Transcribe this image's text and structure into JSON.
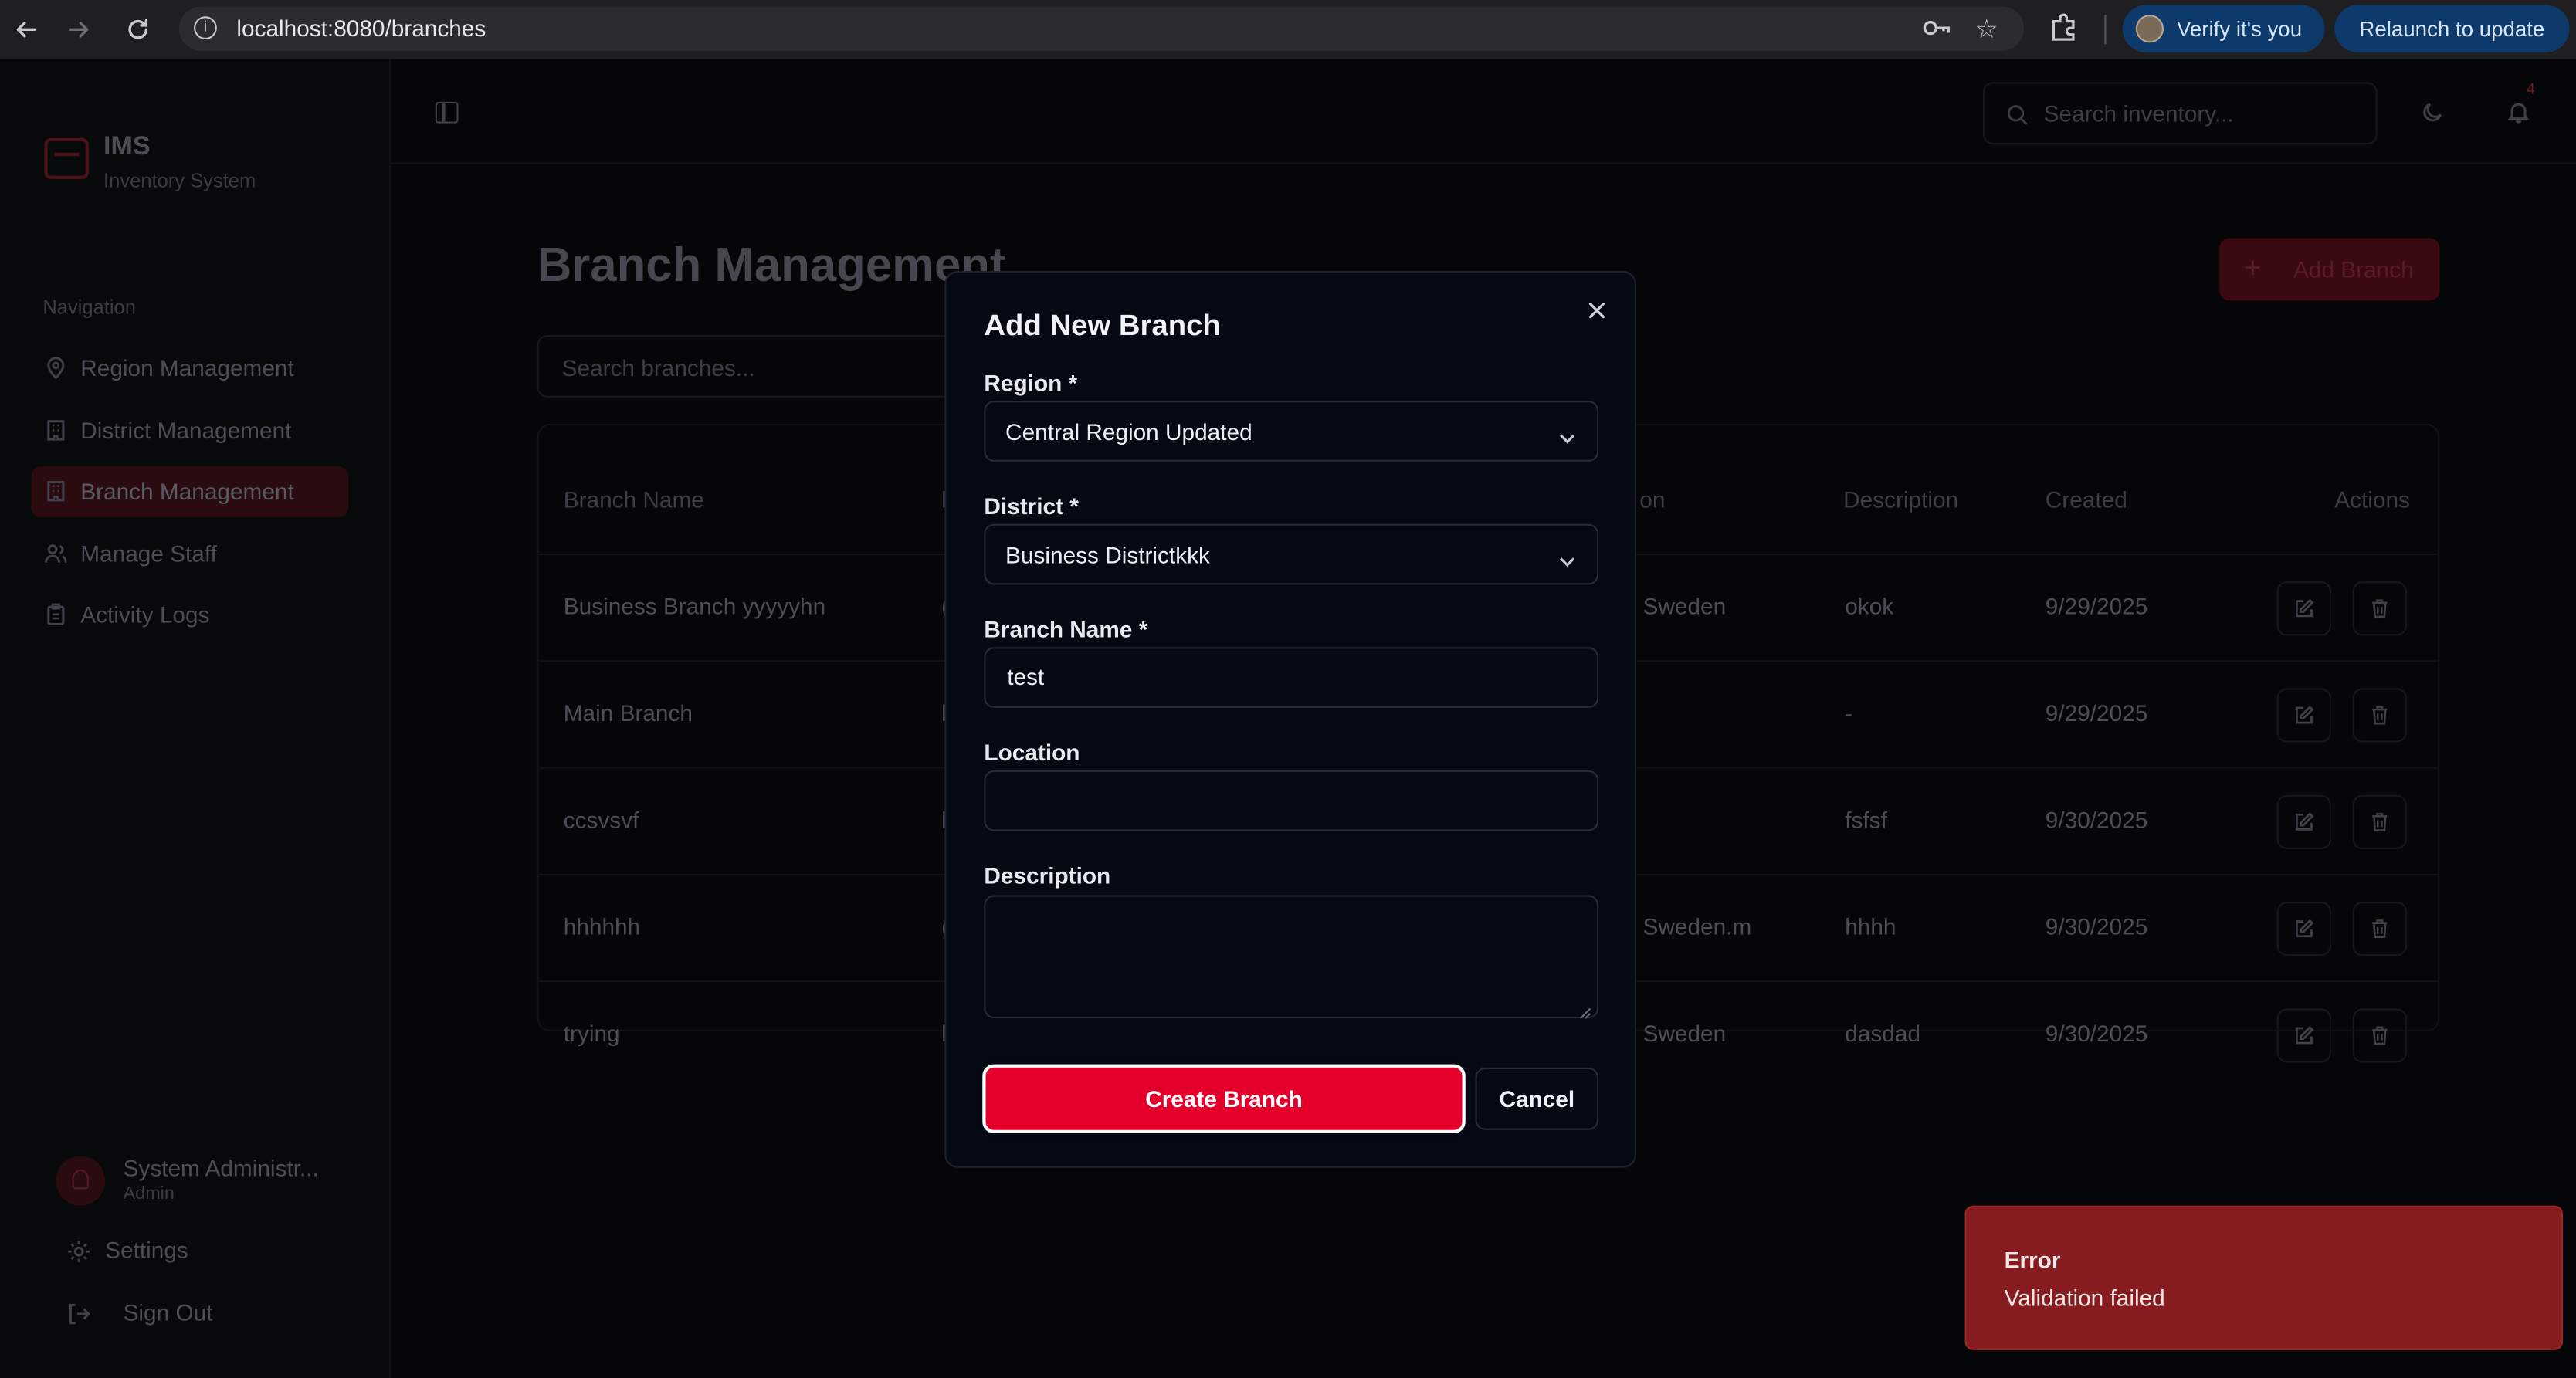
{
  "browser": {
    "url": "localhost:8080/branches",
    "verify_label": "Verify it's you",
    "relaunch_label": "Relaunch to update"
  },
  "sidebar": {
    "brand_title": "IMS",
    "brand_subtitle": "Inventory System",
    "nav_heading": "Navigation",
    "items": [
      {
        "label": "Region Management",
        "icon": "map-pin-icon"
      },
      {
        "label": "District Management",
        "icon": "building-icon"
      },
      {
        "label": "Branch Management",
        "icon": "building-icon",
        "active": true
      },
      {
        "label": "Manage Staff",
        "icon": "users-icon"
      },
      {
        "label": "Activity Logs",
        "icon": "clipboard-icon"
      }
    ],
    "user_name": "System Administr...",
    "user_role": "Admin",
    "settings_label": "Settings",
    "signout_label": "Sign Out"
  },
  "topbar": {
    "search_placeholder": "Search inventory...",
    "notification_count": "4"
  },
  "page": {
    "title": "Branch Management",
    "add_button": "Add Branch",
    "search_placeholder": "Search branches..."
  },
  "table": {
    "headers": {
      "name": "Branch Name",
      "col2": "l",
      "location": "on",
      "description": "Description",
      "created": "Created",
      "actions": "Actions"
    },
    "rows": [
      {
        "name": "Business Branch yyyyyhn",
        "col2": "(",
        "location": "Sweden",
        "description": "okok",
        "created": "9/29/2025"
      },
      {
        "name": "Main Branch",
        "col2": "l",
        "location": "",
        "description": "-",
        "created": "9/29/2025"
      },
      {
        "name": "ccsvsvf",
        "col2": "l",
        "location": "",
        "description": "fsfsf",
        "created": "9/30/2025"
      },
      {
        "name": "hhhhhh",
        "col2": "(",
        "location": "Sweden.m",
        "description": "hhhh",
        "created": "9/30/2025"
      },
      {
        "name": "trying",
        "col2": "l",
        "location": "Sweden",
        "description": "dasdad",
        "created": "9/30/2025"
      }
    ]
  },
  "modal": {
    "title": "Add New Branch",
    "region_label": "Region *",
    "region_value": "Central Region Updated",
    "district_label": "District *",
    "district_value": "Business Districtkkk",
    "branch_name_label": "Branch Name *",
    "branch_name_value": "test",
    "location_label": "Location",
    "location_value": "",
    "description_label": "Description",
    "description_value": "",
    "create_button": "Create Branch",
    "cancel_button": "Cancel"
  },
  "toast": {
    "title": "Error",
    "message": "Validation failed"
  },
  "colors": {
    "accent": "#e4002b",
    "toast_bg": "#861c1f",
    "chrome_pill": "#0d3a6b"
  }
}
